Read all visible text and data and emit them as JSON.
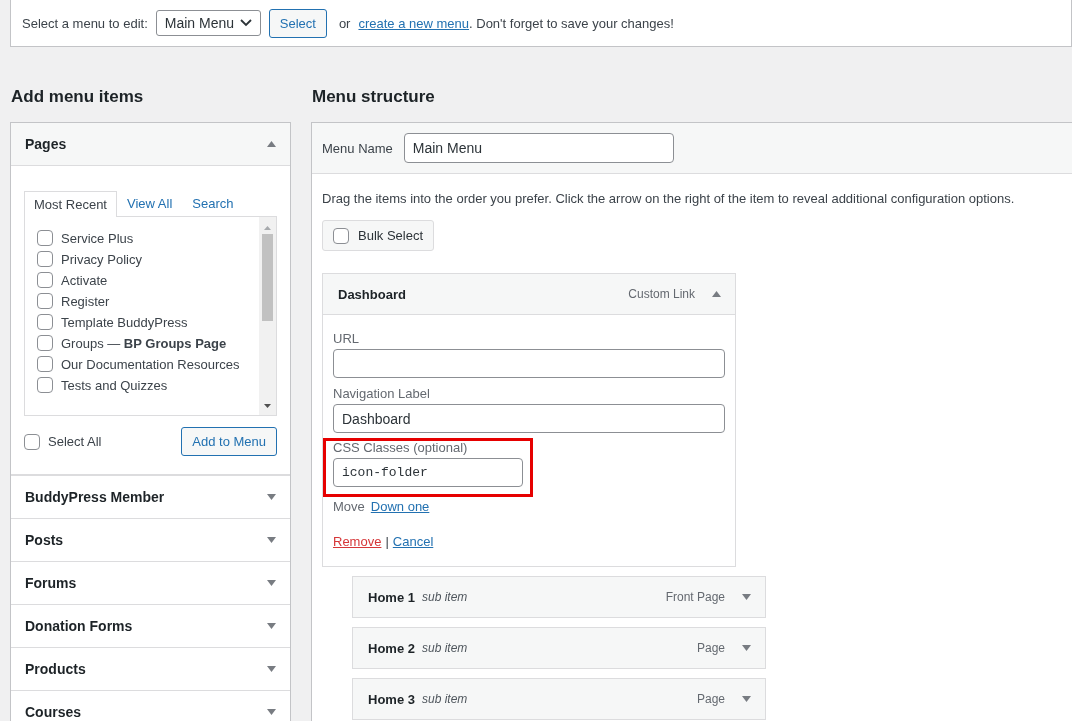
{
  "menu_selector": {
    "label": "Select a menu to edit:",
    "value": "Main Menu",
    "button": "Select",
    "text_before_link": "or",
    "link": "create a new menu",
    "text_after_link": ". Don't forget to save your changes!"
  },
  "add_menu_items": {
    "title": "Add menu items",
    "sections": [
      {
        "title": "Pages",
        "expanded": true,
        "tabs": [
          {
            "label": "Most Recent",
            "selected": true
          },
          {
            "label": "View All",
            "selected": false
          },
          {
            "label": "Search",
            "selected": false
          }
        ],
        "items": [
          {
            "label": "Service Plus",
            "checked": false
          },
          {
            "label": "Privacy Policy",
            "checked": false
          },
          {
            "label": "Activate",
            "checked": false
          },
          {
            "label": "Register",
            "checked": false
          },
          {
            "label": "Template BuddyPress",
            "checked": false
          },
          {
            "label": "Groups — **BP Groups Page**",
            "checked": false
          },
          {
            "label": "Our Documentation Resources",
            "checked": false
          },
          {
            "label": "Tests and Quizzes",
            "checked": false
          }
        ],
        "select_all": {
          "label": "Select All",
          "checked": false
        },
        "button": "Add to Menu"
      },
      {
        "title": "BuddyPress Member",
        "expanded": false
      },
      {
        "title": "Posts",
        "expanded": false
      },
      {
        "title": "Forums",
        "expanded": false
      },
      {
        "title": "Donation Forms",
        "expanded": false
      },
      {
        "title": "Products",
        "expanded": false
      },
      {
        "title": "Courses",
        "expanded": false
      }
    ]
  },
  "menu_structure": {
    "title": "Menu structure",
    "menu_name_label": "Menu Name",
    "menu_name_value": "Main Menu",
    "instructions": "Drag the items into the order you prefer. Click the arrow on the right of the item to reveal additional configuration options.",
    "bulk_select": {
      "label": "Bulk Select",
      "checked": false
    },
    "items": [
      {
        "title": "Dashboard",
        "type": "Custom Link",
        "sub": false,
        "expanded": true,
        "fields": [
          {
            "label": "URL",
            "wide": true,
            "mono": false,
            "highlighted": false
          },
          {
            "label": "Navigation Label",
            "value": "Dashboard",
            "wide": true,
            "mono": false,
            "highlighted": false
          },
          {
            "label": "CSS Classes (optional)",
            "value": "icon-folder",
            "wide": false,
            "mono": true,
            "highlighted": true
          }
        ],
        "move_label": "Move",
        "move_link": "Down one",
        "remove": "Remove",
        "separator": "|",
        "cancel": "Cancel"
      },
      {
        "title": "Home 1",
        "sub_label": "sub item",
        "type": "Front Page",
        "sub": true,
        "expanded": false
      },
      {
        "title": "Home 2",
        "sub_label": "sub item",
        "type": "Page",
        "sub": true,
        "expanded": false
      },
      {
        "title": "Home 3",
        "sub_label": "sub item",
        "type": "Page",
        "sub": true,
        "expanded": false
      }
    ]
  }
}
